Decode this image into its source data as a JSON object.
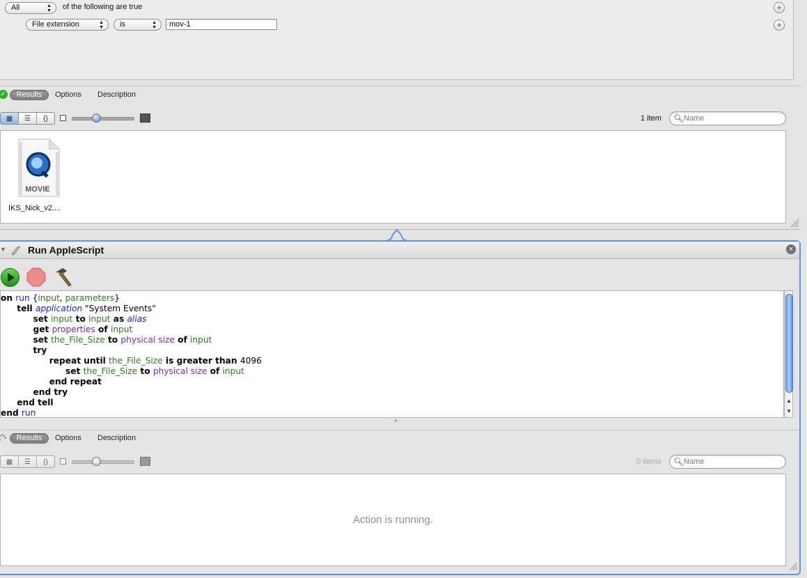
{
  "filter": {
    "match_value": "All",
    "match_suffix": "of the following are true",
    "attribute_value": "File extension",
    "operator_value": "is",
    "criteria_value": "mov-1"
  },
  "results_top": {
    "tabs": [
      "Results",
      "Options",
      "Description"
    ],
    "item_count": "1 item",
    "search_placeholder": "Name",
    "file": {
      "badge": "MOVIE",
      "name": "IKS_Nick_v2...."
    },
    "status_color": "#2fae2f",
    "zoom_level": 0.4
  },
  "action": {
    "title": "Run AppleScript",
    "accent_color": "#5e94df"
  },
  "script": {
    "lines": [
      [
        {
          "t": "on ",
          "c": "kw"
        },
        {
          "t": "run",
          "c": "kwb"
        },
        {
          "t": " {",
          "c": "str"
        },
        {
          "t": "input",
          "c": "var"
        },
        {
          "t": ", ",
          "c": "str"
        },
        {
          "t": "parameters",
          "c": "var"
        },
        {
          "t": "}",
          "c": "str"
        }
      ],
      [
        {
          "t": "      ",
          "c": "str"
        },
        {
          "t": "tell ",
          "c": "kw"
        },
        {
          "t": "application",
          "c": "cls"
        },
        {
          "t": " \"System Events\"",
          "c": "str"
        }
      ],
      [
        {
          "t": "            ",
          "c": "str"
        },
        {
          "t": "set ",
          "c": "kw"
        },
        {
          "t": "input",
          "c": "var"
        },
        {
          "t": " to ",
          "c": "kw"
        },
        {
          "t": "input",
          "c": "var"
        },
        {
          "t": " as ",
          "c": "kw"
        },
        {
          "t": "alias",
          "c": "cls"
        }
      ],
      [
        {
          "t": "            ",
          "c": "str"
        },
        {
          "t": "get ",
          "c": "kw"
        },
        {
          "t": "properties",
          "c": "prop"
        },
        {
          "t": " of ",
          "c": "kw"
        },
        {
          "t": "input",
          "c": "var"
        }
      ],
      [
        {
          "t": "            ",
          "c": "str"
        },
        {
          "t": "set ",
          "c": "kw"
        },
        {
          "t": "the_File_Size",
          "c": "var"
        },
        {
          "t": " to ",
          "c": "kw"
        },
        {
          "t": "physical size",
          "c": "prop"
        },
        {
          "t": " of ",
          "c": "kw"
        },
        {
          "t": "input",
          "c": "var"
        }
      ],
      [
        {
          "t": "            ",
          "c": "str"
        },
        {
          "t": "try",
          "c": "kw"
        }
      ],
      [
        {
          "t": "                  ",
          "c": "str"
        },
        {
          "t": "repeat until ",
          "c": "kw"
        },
        {
          "t": "the_File_Size",
          "c": "var"
        },
        {
          "t": " is greater than ",
          "c": "kw"
        },
        {
          "t": "4096",
          "c": "str"
        }
      ],
      [
        {
          "t": "                        ",
          "c": "str"
        },
        {
          "t": "set ",
          "c": "kw"
        },
        {
          "t": "the_File_Size",
          "c": "var"
        },
        {
          "t": " to ",
          "c": "kw"
        },
        {
          "t": "physical size",
          "c": "prop"
        },
        {
          "t": " of ",
          "c": "kw"
        },
        {
          "t": "input",
          "c": "var"
        }
      ],
      [
        {
          "t": "                  ",
          "c": "str"
        },
        {
          "t": "end repeat",
          "c": "kw"
        }
      ],
      [
        {
          "t": "            ",
          "c": "str"
        },
        {
          "t": "end try",
          "c": "kw"
        }
      ],
      [
        {
          "t": "      ",
          "c": "str"
        },
        {
          "t": "end tell",
          "c": "kw"
        }
      ],
      [
        {
          "t": "end ",
          "c": "kw"
        },
        {
          "t": "run",
          "c": "kwb"
        }
      ]
    ]
  },
  "results_bottom": {
    "tabs": [
      "Results",
      "Options",
      "Description"
    ],
    "item_count": "0 items",
    "search_placeholder": "Name",
    "running_message": "Action is running.",
    "zoom_level": 0.4
  }
}
